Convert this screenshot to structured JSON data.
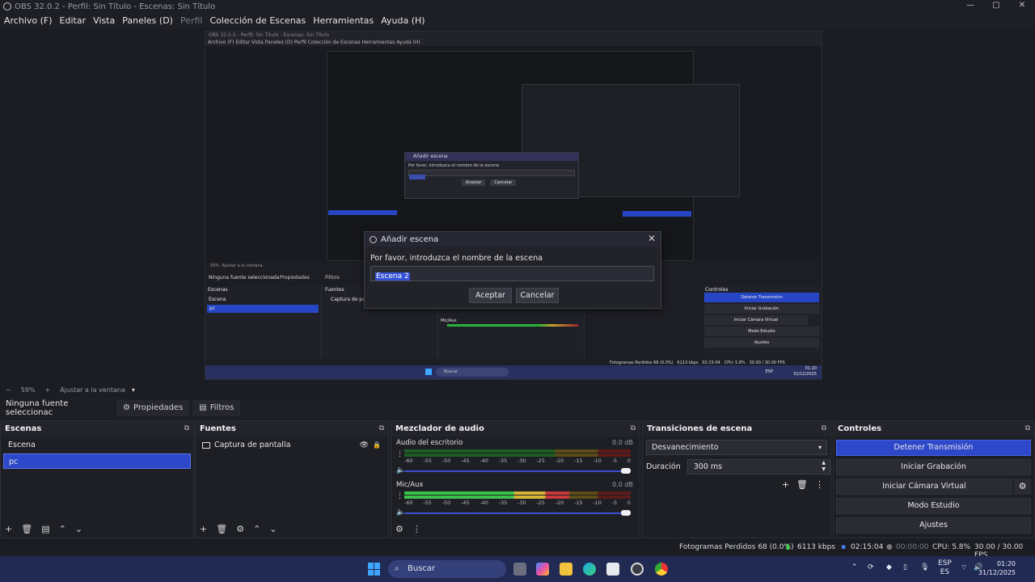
{
  "window": {
    "title": "OBS 32.0.2 - Perfil: Sin Título - Escenas: Sin Título",
    "controls": [
      "—",
      "▢",
      "✕"
    ]
  },
  "menu": [
    "Archivo (F)",
    "Editar",
    "Vista",
    "Paneles (D)",
    "Perfil",
    "Colección de Escenas",
    "Herramientas",
    "Ayuda (H)"
  ],
  "preview_nested": {
    "title": "OBS 32.0.2 - Perfil: Sin Título - Escenas: Sin Título",
    "menu": "Archivo (F)   Editar   Vista   Paneles (D)   Perfil   Colección de Escenas   Herramientas   Ayuda (H)",
    "dialog_title": "Añadir escena",
    "dialog_prompt": "Por favor, introduzca el nombre de la escena",
    "dialog_value": "Escena 2",
    "accept": "Aceptar",
    "cancel": "Cancelar",
    "zoom": "59%",
    "fit": "Ajustar a la ventana",
    "no_source": "Ninguna fuente seleccionada",
    "props": "Propiedades",
    "filters": "Filtros",
    "scenes_title": "Escenas",
    "sources_title": "Fuentes",
    "scene1": "Escena",
    "scene2": "pc",
    "source1": "Captura de pa",
    "mic": "Mic/Aux",
    "controls_title": "Controles",
    "ctl_stop": "Detener Transmisión",
    "ctl_rec": "Iniciar Grabación",
    "ctl_vcam": "Iniciar Cámara Virtual",
    "ctl_studio": "Modo Estudio",
    "ctl_settings": "Ajustes",
    "status": "Fotogramas Perdidos 68 (0.0%)",
    "kbps": "6113 kbps",
    "time": "02:15:04",
    "cpu": "CPU: 5.8%",
    "fps": "30.00 / 30.00 FPS",
    "search": "Buscar",
    "lang": "ESP",
    "clock_time": "01:20",
    "clock_date": "31/12/2025"
  },
  "dialog": {
    "title": "Añadir escena",
    "prompt": "Por favor, introduzca el nombre de la escena",
    "value": "Escena 2",
    "accept": "Aceptar",
    "cancel": "Cancelar",
    "close": "✕"
  },
  "zoom": {
    "minus": "−",
    "value": "59%",
    "plus": "+",
    "fit": "Ajustar a la ventana"
  },
  "source_toolbar": {
    "none_selected": "Ninguna fuente seleccionac",
    "properties": "Propiedades",
    "filters": "Filtros"
  },
  "scenes": {
    "title": "Escenas",
    "items": [
      "Escena",
      "pc"
    ],
    "selected": 1
  },
  "sources": {
    "title": "Fuentes",
    "items": [
      "Captura de pantalla"
    ]
  },
  "mixer": {
    "title": "Mezclador de audio",
    "channels": [
      {
        "name": "Audio del escritorio",
        "db": "0.0 dB",
        "level": 0.0
      },
      {
        "name": "Mic/Aux",
        "db": "0.0 dB",
        "level": 0.73
      }
    ],
    "ticks": [
      "-60",
      "-55",
      "-50",
      "-45",
      "-40",
      "-35",
      "-30",
      "-25",
      "-20",
      "-15",
      "-10",
      "-5",
      "0"
    ]
  },
  "transitions": {
    "title": "Transiciones de escena",
    "selected": "Desvanecimiento",
    "duration_label": "Duración",
    "duration_value": "300 ms"
  },
  "controls": {
    "title": "Controles",
    "stop_stream": "Detener Transmisión",
    "start_recording": "Iniciar Grabación",
    "start_vcam": "Iniciar Cámara Virtual",
    "studio_mode": "Modo Estudio",
    "settings": "Ajustes"
  },
  "status": {
    "dropped": "Fotogramas Perdidos 68 (0.0%)",
    "kbps": "6113 kbps",
    "stream_time": "02:15:04",
    "rec_time": "00:00:00",
    "cpu": "CPU: 5.8%",
    "fps": "30.00 / 30.00 FPS"
  },
  "taskbar": {
    "search": "Buscar",
    "lang_top": "ESP",
    "lang_bottom": "ES",
    "time": "01:20",
    "date": "31/12/2025"
  },
  "colors": {
    "accent": "#2d48c9",
    "taskbar": "#202a52",
    "panel": "#1e1f25"
  }
}
